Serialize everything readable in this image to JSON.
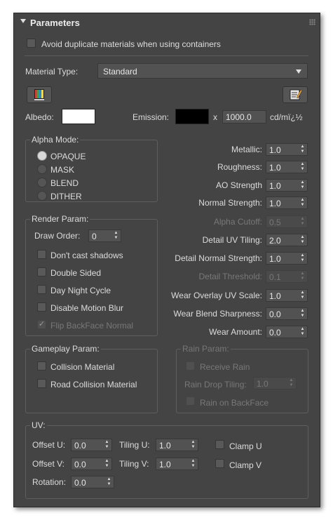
{
  "header": {
    "title": "Parameters",
    "collapse_icon": "triangle-down-icon",
    "grip_icon": "grip-dots-icon"
  },
  "avoid_duplicates": {
    "label": "Avoid duplicate materials when using containers",
    "checked": false
  },
  "material_type": {
    "label": "Material Type:",
    "value": "Standard"
  },
  "icons": {
    "left": "color-palette-icon",
    "right": "edit-sheet-icon"
  },
  "albedo": {
    "label": "Albedo:",
    "color": "#ffffff"
  },
  "emission": {
    "label": "Emission:",
    "color": "#000000",
    "x": "x",
    "multiplier": "1000.0",
    "unit": "cd/mï¿½"
  },
  "alpha_mode": {
    "title": "Alpha Mode:",
    "options": [
      "OPAQUE",
      "MASK",
      "BLEND",
      "DITHER"
    ],
    "selected": "OPAQUE"
  },
  "properties": [
    {
      "label": "Metallic:",
      "value": "1.0",
      "enabled": true
    },
    {
      "label": "Roughness:",
      "value": "1.0",
      "enabled": true
    },
    {
      "label": "AO Strength",
      "value": "1.0",
      "enabled": true
    },
    {
      "label": "Normal Strength:",
      "value": "1.0",
      "enabled": true
    },
    {
      "label": "Alpha Cutoff:",
      "value": "0.5",
      "enabled": false
    },
    {
      "label": "Detail UV Tiling:",
      "value": "2.0",
      "enabled": true
    },
    {
      "label": "Detail Normal Strength:",
      "value": "1.0",
      "enabled": true
    },
    {
      "label": "Detail Threshold:",
      "value": "0.1",
      "enabled": false
    },
    {
      "label": "Wear Overlay UV Scale:",
      "value": "1.0",
      "enabled": true
    },
    {
      "label": "Wear Blend Sharpness:",
      "value": "0.0",
      "enabled": true
    },
    {
      "label": "Wear Amount:",
      "value": "0.0",
      "enabled": true
    }
  ],
  "render_param": {
    "title": "Render Param:",
    "draw_order_label": "Draw Order:",
    "draw_order_value": "0",
    "checkboxes": [
      {
        "label": "Don't cast shadows",
        "checked": false,
        "enabled": true
      },
      {
        "label": "Double Sided",
        "checked": false,
        "enabled": true
      },
      {
        "label": "Day Night Cycle",
        "checked": false,
        "enabled": true
      },
      {
        "label": "Disable Motion Blur",
        "checked": false,
        "enabled": true
      },
      {
        "label": "Flip BackFace Normal",
        "checked": true,
        "enabled": false
      }
    ]
  },
  "gameplay_param": {
    "title": "Gameplay Param:",
    "checkboxes": [
      {
        "label": "Collision Material",
        "checked": false
      },
      {
        "label": "Road Collision Material",
        "checked": false
      }
    ]
  },
  "rain_param": {
    "title": "Rain Param:",
    "receive_rain": "Receive Rain",
    "drop_tiling_label": "Rain Drop Tiling:",
    "drop_tiling_value": "1.0",
    "rain_on_backface": "Rain on BackFace"
  },
  "uv": {
    "title": "UV:",
    "offset_u_label": "Offset U:",
    "offset_u": "0.0",
    "offset_v_label": "Offset V:",
    "offset_v": "0.0",
    "tiling_u_label": "Tiling U:",
    "tiling_u": "1.0",
    "tiling_v_label": "Tiling V:",
    "tiling_v": "1.0",
    "rotation_label": "Rotation:",
    "rotation": "0.0",
    "clamp_u": "Clamp U",
    "clamp_v": "Clamp V"
  }
}
